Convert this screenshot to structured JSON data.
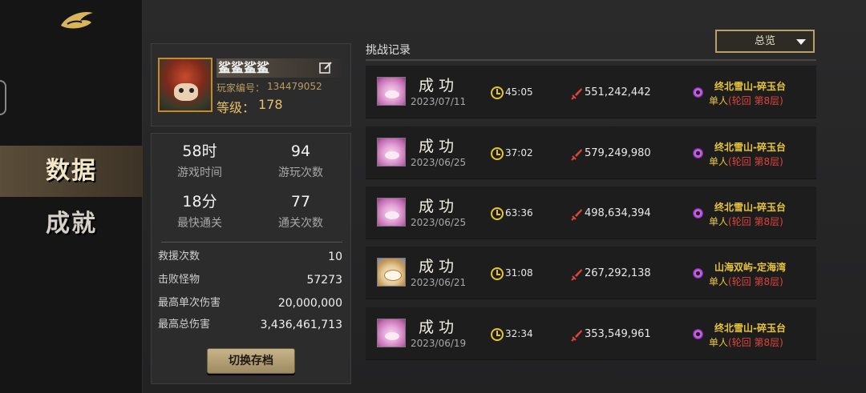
{
  "nav": {
    "tabs": [
      {
        "label": "数据",
        "active": true
      },
      {
        "label": "成就",
        "active": false
      }
    ]
  },
  "profile": {
    "name": "鲨鲨鲨鲨",
    "id_label": "玩家编号：",
    "id": "134479052",
    "level_label": "等级：",
    "level": "178"
  },
  "stats": {
    "play_time": {
      "value": "58时",
      "label": "游戏时间"
    },
    "play_count": {
      "value": "94",
      "label": "游玩次数"
    },
    "fastest_clear": {
      "value": "18分",
      "label": "最快通关"
    },
    "clear_count": {
      "value": "77",
      "label": "通关次数"
    },
    "rows": [
      {
        "label": "救援次数",
        "value": "10"
      },
      {
        "label": "击败怪物",
        "value": "57273"
      },
      {
        "label": "最高单次伤害",
        "value": "20,000,000"
      },
      {
        "label": "最高总伤害",
        "value": "3,436,461,713"
      }
    ],
    "switch_button": "切换存档"
  },
  "records": {
    "title": "挑战记录",
    "filter": "总览",
    "items": [
      {
        "result": "成功",
        "date": "2023/07/11",
        "time": "45:05",
        "damage": "551,242,442",
        "location": "终北雪山-碎玉台",
        "mode": "单人",
        "mode_detail": "(轮回 第8层)",
        "avatar": "pink-hero"
      },
      {
        "result": "成功",
        "date": "2023/06/25",
        "time": "37:02",
        "damage": "579,249,980",
        "location": "终北雪山-碎玉台",
        "mode": "单人",
        "mode_detail": "(轮回 第8层)",
        "avatar": "pink-hero"
      },
      {
        "result": "成功",
        "date": "2023/06/25",
        "time": "63:36",
        "damage": "498,634,394",
        "location": "终北雪山-碎玉台",
        "mode": "单人",
        "mode_detail": "(轮回 第8层)",
        "avatar": "pink-hero"
      },
      {
        "result": "成功",
        "date": "2023/06/21",
        "time": "31:08",
        "damage": "267,292,138",
        "location": "山海双屿-定海湾",
        "mode": "单人",
        "mode_detail": "(轮回 第8层)",
        "avatar": "cat-hero"
      },
      {
        "result": "成功",
        "date": "2023/06/19",
        "time": "32:34",
        "damage": "353,549,961",
        "location": "终北雪山-碎玉台",
        "mode": "单人",
        "mode_detail": "(轮回 第8层)",
        "avatar": "pink-hero"
      }
    ]
  },
  "colors": {
    "accent_gold": "#e8c43c",
    "red": "#e0443a",
    "purple": "#c35ee0"
  }
}
